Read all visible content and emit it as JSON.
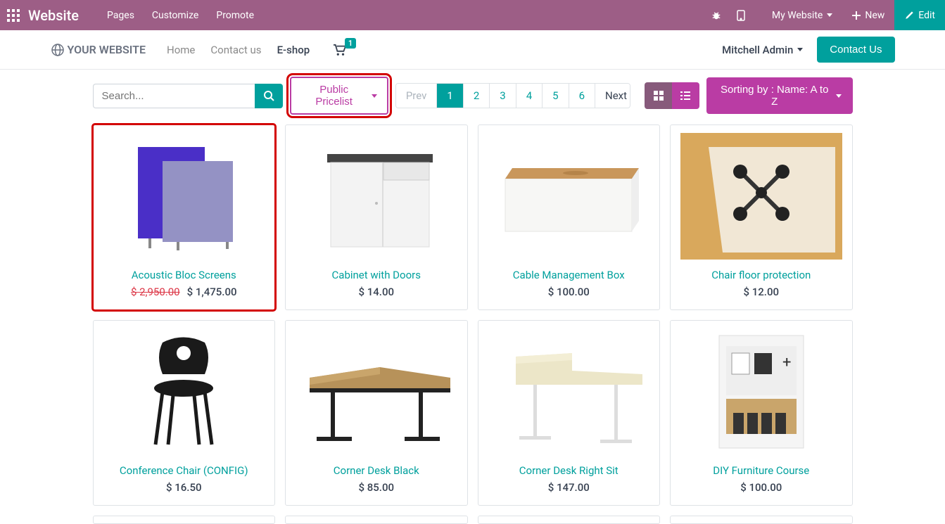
{
  "topbar": {
    "brand": "Website",
    "links": [
      "Pages",
      "Customize",
      "Promote"
    ],
    "mywebsite": "My Website",
    "new": "New",
    "edit": "Edit"
  },
  "nav": {
    "logo": "YOUR WEBSITE",
    "links": [
      {
        "label": "Home",
        "active": false
      },
      {
        "label": "Contact us",
        "active": false
      },
      {
        "label": "E-shop",
        "active": true
      }
    ],
    "cart_count": "1",
    "user": "Mitchell Admin",
    "contact_btn": "Contact Us"
  },
  "toolbar": {
    "search_placeholder": "Search...",
    "pricelist": "Public Pricelist",
    "pager": {
      "prev": "Prev",
      "pages": [
        "1",
        "2",
        "3",
        "4",
        "5",
        "6"
      ],
      "active": "1",
      "next": "Next"
    },
    "sort": "Sorting by : Name: A to Z"
  },
  "products": [
    {
      "title": "Acoustic Bloc Screens",
      "old_price": "$ 2,950.00",
      "price": "$ 1,475.00",
      "highlight": true
    },
    {
      "title": "Cabinet with Doors",
      "price": "$ 14.00"
    },
    {
      "title": "Cable Management Box",
      "price": "$ 100.00"
    },
    {
      "title": "Chair floor protection",
      "price": "$ 12.00"
    },
    {
      "title": "Conference Chair (CONFIG)",
      "price": "$ 16.50"
    },
    {
      "title": "Corner Desk Black",
      "price": "$ 85.00"
    },
    {
      "title": "Corner Desk Right Sit",
      "price": "$ 147.00"
    },
    {
      "title": "DIY Furniture Course",
      "price": "$ 100.00"
    }
  ]
}
